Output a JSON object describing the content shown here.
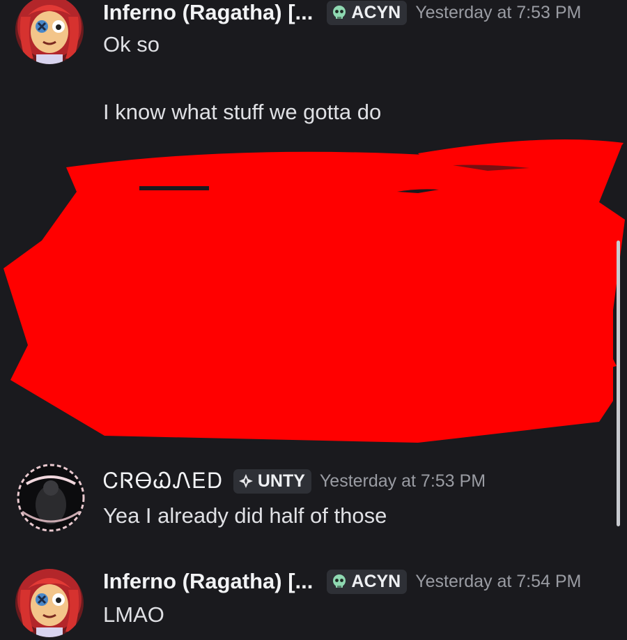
{
  "messages": [
    {
      "author": "Inferno (Ragatha) [...",
      "tag": "ACYN",
      "tag_icon": "skull-icon",
      "timestamp": "Yesterday at 7:53 PM",
      "lines": [
        "Ok so",
        "I know what stuff we gotta do"
      ]
    },
    {
      "author": "ᏟᏒᎾᏇᏁᎬᎠ",
      "tag": "UNTY",
      "tag_icon": "diamond-cross-icon",
      "timestamp": "Yesterday at 7:53 PM",
      "lines": [
        "Yea I already did half of those"
      ]
    },
    {
      "author": "Inferno (Ragatha) [...",
      "tag": "ACYN",
      "tag_icon": "skull-icon",
      "timestamp": "Yesterday at 7:54 PM",
      "lines": [
        "LMAO"
      ]
    }
  ],
  "colors": {
    "background": "#1a1a1e",
    "redaction": "#ff0000",
    "tag_bg": "#2e3036",
    "skull": "#8fd9b2"
  }
}
